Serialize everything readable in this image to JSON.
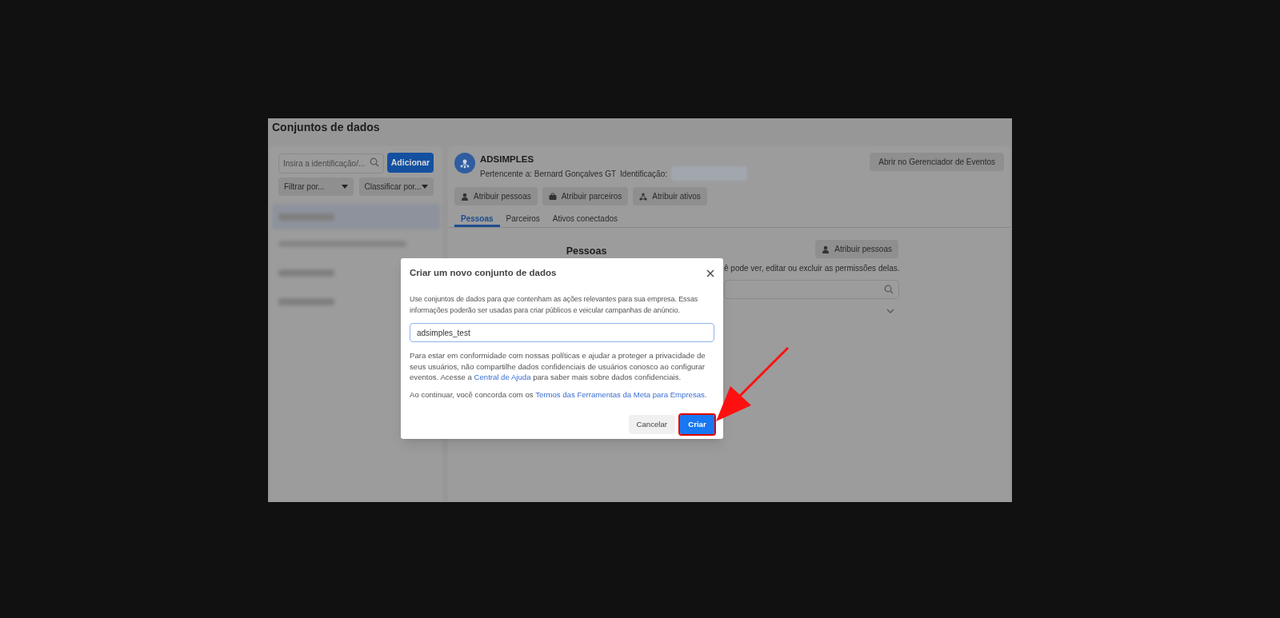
{
  "page": {
    "title": "Conjuntos de dados"
  },
  "sidebar": {
    "search": {
      "placeholder": "Insira a identificação/..."
    },
    "add_button": "Adicionar",
    "filters": [
      "Filtrar por...",
      "Classificar por..."
    ]
  },
  "dataset": {
    "name": "ADSIMPLES",
    "owner": "Pertencente a: Bernard Gonçalves GT",
    "id_label": "Identificação:",
    "open_button": "Abrir no Gerenciador de Eventos",
    "actions": [
      {
        "kind": "person",
        "label": "Atribuir pessoas"
      },
      {
        "kind": "briefcase",
        "label": "Atribuir parceiros"
      },
      {
        "kind": "nodes",
        "label": "Atribuir ativos"
      }
    ],
    "tabs": [
      {
        "label": "Pessoas",
        "selected": true
      },
      {
        "label": "Parceiros",
        "selected": false
      },
      {
        "label": "Ativos conectados",
        "selected": false
      }
    ],
    "section": {
      "title": "Pessoas",
      "assign_button": "Atribuir pessoas",
      "description_visible": "ê pode ver, editar ou excluir as permissões delas."
    }
  },
  "dialog": {
    "title": "Criar um novo conjunto de dados",
    "intro": "Use conjuntos de dados para que contenham as ações relevantes para sua empresa. Essas informações poderão ser usadas para criar públicos e veicular campanhas de anúncio.",
    "input_value": "adsimples_test",
    "privacy_before": "Para estar em conformidade com nossas políticas e ajudar a proteger a privacidade de seus usuários, não compartilhe dados confidenciais de usuários conosco ao configurar eventos. Acesse a ",
    "privacy_link": "Central de Ajuda",
    "privacy_after": " para saber mais sobre dados confidenciais.",
    "terms_before": "Ao continuar, você concorda com os ",
    "terms_link": "Termos das Ferramentas da Meta para Empresas",
    "terms_after": ".",
    "cancel": "Cancelar",
    "create": "Criar",
    "create_highlighted": true
  }
}
